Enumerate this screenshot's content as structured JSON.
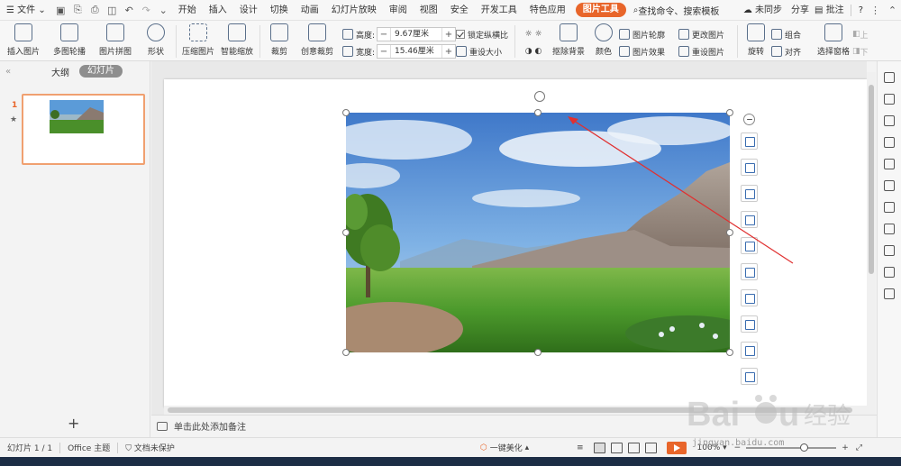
{
  "menubar": {
    "file_label": "文件",
    "tabs": [
      "开始",
      "插入",
      "设计",
      "切换",
      "动画",
      "幻灯片放映",
      "审阅",
      "视图",
      "安全",
      "开发工具",
      "特色应用"
    ],
    "active_tab": "图片工具",
    "search_label": "查找命令、搜索模板",
    "sync_label": "未同步",
    "share_label": "分享",
    "comment_label": "批注",
    "help_label": "?"
  },
  "ribbon": {
    "insert_picture": "插入图片",
    "multi_outline": "多图轮播",
    "picture_collage": "图片拼图",
    "shape": "形状",
    "compress": "压缩图片",
    "smart_zoom": "智能缩放",
    "crop": "裁剪",
    "creative_crop": "创意裁剪",
    "height_label": "高度:",
    "height_value": "9.67厘米",
    "width_label": "宽度:",
    "width_value": "15.46厘米",
    "lock_ratio": "锁定纵横比",
    "reset_size": "重设大小",
    "remove_bg": "抠除背景",
    "color": "颜色",
    "pic_outline": "图片轮廓",
    "pic_effect": "图片效果",
    "change_pic": "更改图片",
    "reset_pic": "重设图片",
    "rotate": "旋转",
    "group": "组合",
    "align": "对齐",
    "select_pane": "选择窗格",
    "up": "上",
    "down": "下"
  },
  "leftpanel": {
    "tab_outline": "大纲",
    "tab_slides": "幻灯片",
    "slide_number": "1"
  },
  "notes": {
    "placeholder": "单击此处添加备注"
  },
  "statusbar": {
    "slide_info": "幻灯片 1 / 1",
    "theme": "Office 主题",
    "protection": "文档未保护",
    "beautify": "一键美化",
    "zoom": "100%"
  },
  "watermark": {
    "text": "jingyan.baidu.com"
  },
  "colors": {
    "accent": "#e8652a",
    "arrow": "#e03030"
  }
}
